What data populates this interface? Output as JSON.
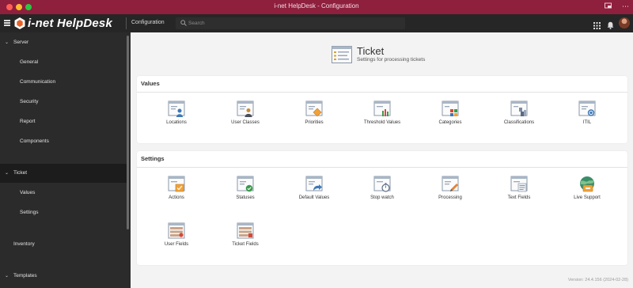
{
  "window": {
    "title": "i-net HelpDesk - Configuration"
  },
  "header": {
    "app_name": "i-net HelpDesk",
    "section": "Configuration",
    "search_placeholder": "Search"
  },
  "sidebar": {
    "server": {
      "label": "Server",
      "children": [
        "General",
        "Communication",
        "Security",
        "Report",
        "Components"
      ]
    },
    "ticket": {
      "label": "Ticket",
      "children": [
        "Values",
        "Settings"
      ]
    },
    "inventory": "Inventory",
    "templates": "Templates"
  },
  "page": {
    "title": "Ticket",
    "subtitle": "Settings for processing tickets"
  },
  "values_card": {
    "title": "Values",
    "items": [
      {
        "label": "Locations",
        "icon": "locations-icon"
      },
      {
        "label": "User Classes",
        "icon": "user-classes-icon"
      },
      {
        "label": "Priorities",
        "icon": "priorities-icon"
      },
      {
        "label": "Threshold Values",
        "icon": "threshold-values-icon"
      },
      {
        "label": "Categories",
        "icon": "categories-icon"
      },
      {
        "label": "Classifications",
        "icon": "classifications-icon"
      },
      {
        "label": "ITIL",
        "icon": "itil-icon"
      }
    ]
  },
  "settings_card": {
    "title": "Settings",
    "items": [
      {
        "label": "Actions",
        "icon": "actions-icon"
      },
      {
        "label": "Statuses",
        "icon": "statuses-icon"
      },
      {
        "label": "Default Values",
        "icon": "default-values-icon"
      },
      {
        "label": "Stop watch",
        "icon": "stop-watch-icon"
      },
      {
        "label": "Processing",
        "icon": "processing-icon"
      },
      {
        "label": "Text Fields",
        "icon": "text-fields-icon"
      },
      {
        "label": "Live Support",
        "icon": "live-support-icon"
      },
      {
        "label": "User Fields",
        "icon": "user-fields-icon"
      },
      {
        "label": "Ticket Fields",
        "icon": "ticket-fields-icon"
      }
    ]
  },
  "footer": {
    "version": "Version: 24.4.156 (2024-02-28)"
  },
  "colors": {
    "titlebar": "#8e1f3d",
    "header": "#262626",
    "sidebar": "#2b2b2b",
    "main_bg": "#f3f3f3",
    "card_bg": "#ffffff"
  }
}
